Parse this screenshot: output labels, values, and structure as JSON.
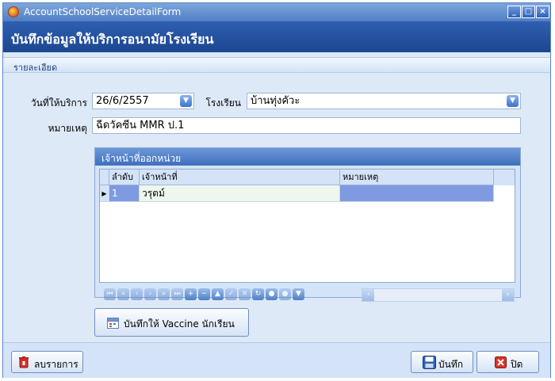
{
  "window": {
    "title": "AccountSchoolServiceDetailForm",
    "controls": {
      "minimize": "_",
      "maximize": "□",
      "close": "×"
    }
  },
  "header": {
    "title": "บันทึกข้อมูลให้บริการอนามัยโรงเรียน"
  },
  "section": {
    "label": "รายละเอียด"
  },
  "form": {
    "service_date_label": "วันที่ให้บริการ",
    "service_date_value": "26/6/2557",
    "school_label": "โรงเรียน",
    "school_value": "บ้านทุ่งคัวะ",
    "note_label": "หมายเหตุ",
    "note_value": "ฉีดวัคซีน MMR ป.1"
  },
  "staff_group": {
    "title": "เจ้าหน้าที่ออกหน่วย",
    "columns": [
      "ลำดับ",
      "เจ้าหน้าที่",
      "หมายเหตุ"
    ],
    "rows": [
      {
        "no": "1",
        "staff": "วรุตม์",
        "note": ""
      }
    ]
  },
  "vaccine_button": {
    "label": "บันทึกให้ Vaccine นักเรียน"
  },
  "footer": {
    "delete_label": "ลบรายการ",
    "save_label": "บันทึก",
    "close_label": "ปิด"
  },
  "icons": {
    "combo_dropdown": "chevron-down-icon",
    "vaccine": "calendar-icon",
    "delete": "trash-icon",
    "save": "save-icon",
    "close": "close-icon"
  },
  "colors": {
    "header_bg": "#1c4690",
    "selected_cell": "#7f9ae0"
  }
}
